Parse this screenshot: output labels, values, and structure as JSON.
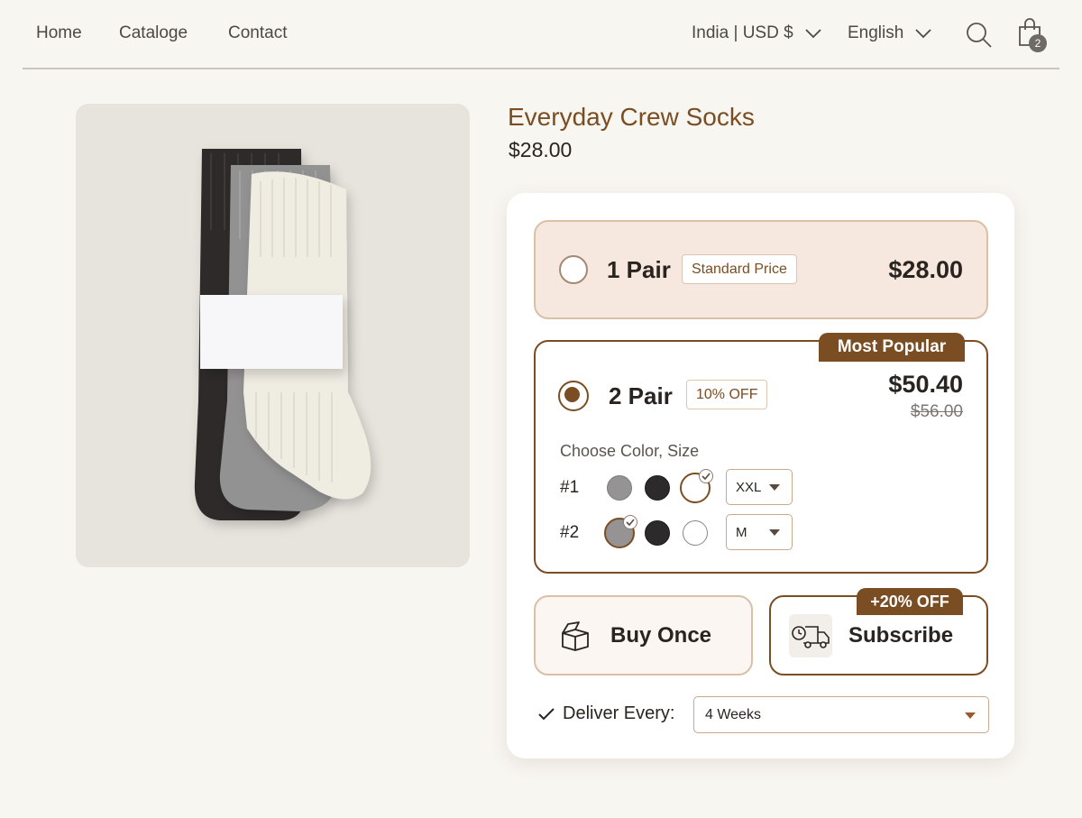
{
  "nav": {
    "links": [
      "Home",
      "Cataloge",
      "Contact"
    ],
    "region": "India | USD $",
    "language": "English",
    "cart_count": "2",
    "icons": [
      "search-icon",
      "shopping-bag-icon",
      "chevron-down-icon"
    ]
  },
  "product": {
    "title": "Everyday Crew Socks",
    "price": "$28.00",
    "image": "sock-bundle-photo"
  },
  "bundles": {
    "option1": {
      "label": "1 Pair",
      "tag": "Standard Price",
      "price": "$28.00",
      "selected": false
    },
    "option2": {
      "badge": "Most Popular",
      "label": "2 Pair",
      "tag": "10% OFF",
      "price": "$50.40",
      "original_price": "$56.00",
      "selected": true,
      "choose_label": "Choose Color, Size",
      "rows": [
        {
          "label": "#1",
          "colors": [
            "grey",
            "black",
            "white"
          ],
          "selected_color": "white",
          "size": "XXL"
        },
        {
          "label": "#2",
          "colors": [
            "grey",
            "black",
            "white"
          ],
          "selected_color": "grey",
          "size": "M"
        }
      ]
    }
  },
  "purchase": {
    "buy_once_label": "Buy Once",
    "subscribe_label": "Subscribe",
    "subscribe_badge": "+20% OFF",
    "deliver_label": "Deliver Every:",
    "deliver_value": "4 Weeks"
  },
  "colors": {
    "accent": "#7b4d22",
    "background": "#f8f6f1",
    "highlight": "#f6e8de"
  }
}
